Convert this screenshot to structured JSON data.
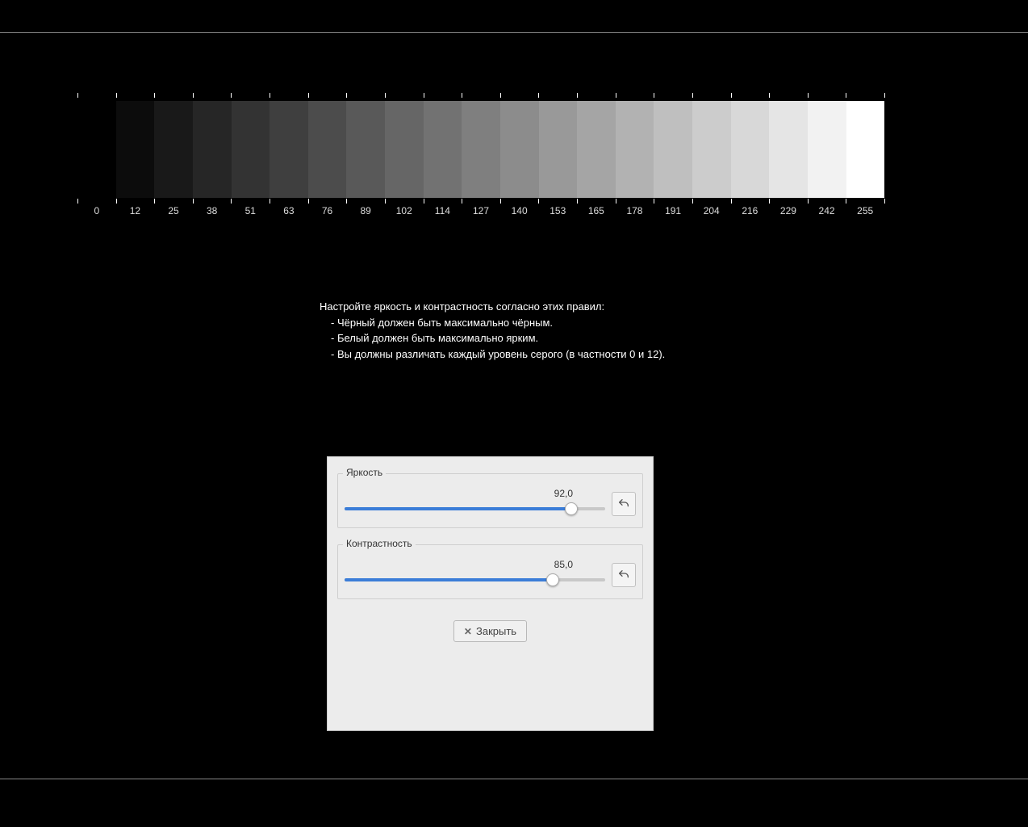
{
  "grayscale": {
    "values": [
      0,
      12,
      25,
      38,
      51,
      63,
      76,
      89,
      102,
      114,
      127,
      140,
      153,
      165,
      178,
      191,
      204,
      216,
      229,
      242,
      255
    ]
  },
  "instructions": {
    "heading": "Настройте яркость и контрастность согласно этих правил:",
    "rule1": "- Чёрный должен быть максимально чёрным.",
    "rule2": "- Белый должен быть максимально ярким.",
    "rule3": "- Вы должны различать каждый уровень серого (в частности 0 и 12)."
  },
  "dialog": {
    "brightness": {
      "label": "Яркость",
      "value_text": "92,0",
      "value": 92.0,
      "percent": 87
    },
    "contrast": {
      "label": "Контрастность",
      "value_text": "85,0",
      "value": 85.0,
      "percent": 80
    },
    "close_label": "Закрыть"
  }
}
